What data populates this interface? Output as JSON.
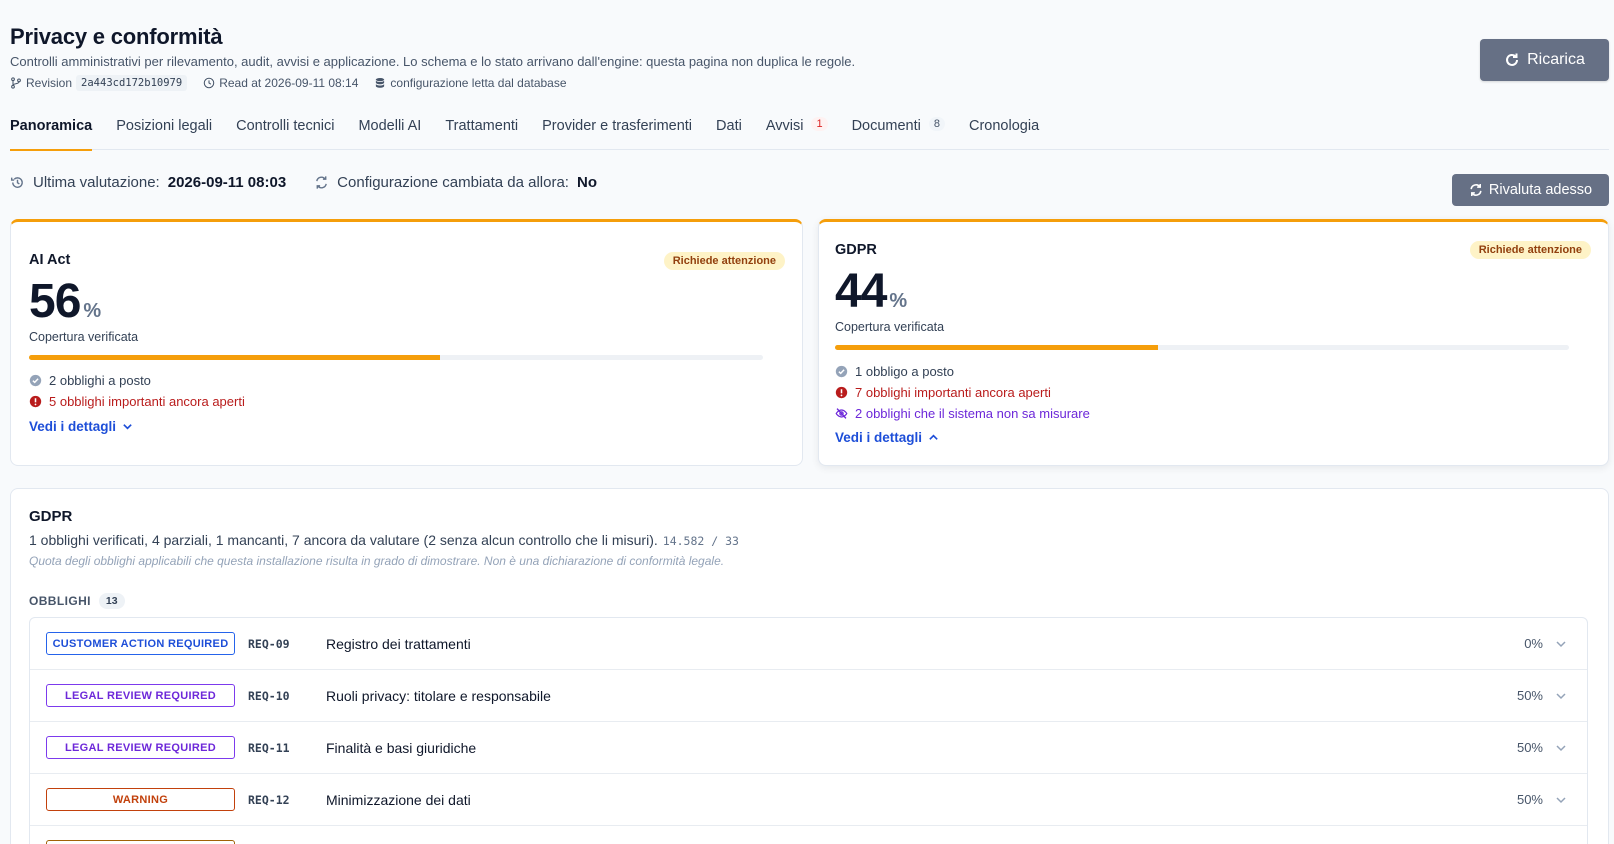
{
  "header": {
    "title": "Privacy e conformità",
    "subtitle": "Controlli amministrativi per rilevamento, audit, avvisi e applicazione. Lo schema e lo stato arrivano dall'engine: questa pagina non duplica le regole.",
    "revision_label": "Revision",
    "revision_code": "2a443cd172b10979",
    "read_at": "Read at 2026-09-11 08:14",
    "config_source": "configurazione letta dal database",
    "reload_label": "Ricarica"
  },
  "tabs": [
    {
      "label": "Panoramica",
      "active": true
    },
    {
      "label": "Posizioni legali"
    },
    {
      "label": "Controlli tecnici"
    },
    {
      "label": "Modelli AI"
    },
    {
      "label": "Trattamenti"
    },
    {
      "label": "Provider e trasferimenti"
    },
    {
      "label": "Dati"
    },
    {
      "label": "Avvisi",
      "badge": "1"
    },
    {
      "label": "Documenti",
      "badge": "8"
    },
    {
      "label": "Cronologia"
    }
  ],
  "evaluation": {
    "last_label": "Ultima valutazione:",
    "last_value": "2026-09-11 08:03",
    "changed_label": "Configurazione cambiata da allora:",
    "changed_value": "No",
    "reevaluate_label": "Rivaluta adesso"
  },
  "cards": {
    "ai_act": {
      "name": "AI Act",
      "status": "Richiede attenzione",
      "percent": "56",
      "percent_sign": "%",
      "coverage_label": "Copertura verificata",
      "coverage_fraction": 0.56,
      "ok": "2 obblighi a posto",
      "open": "5 obblighi importanti ancora aperti",
      "details": "Vedi i dettagli"
    },
    "gdpr": {
      "name": "GDPR",
      "status": "Richiede attenzione",
      "percent": "44",
      "percent_sign": "%",
      "coverage_label": "Copertura verificata",
      "coverage_fraction": 0.44,
      "ok": "1 obbligo a posto",
      "open": "7 obblighi importanti ancora aperti",
      "unmeasurable": "2 obblighi che il sistema non sa misurare",
      "details": "Vedi i dettagli"
    }
  },
  "gdpr_panel": {
    "title": "GDPR",
    "summary": "1 obblighi verificati, 4 parziali, 1 mancanti, 7 ancora da valutare (2 senza alcun controllo che li misuri).",
    "score": "14.582 / 33",
    "note": "Quota degli obblighi applicabili che questa installazione risulta in grado di dimostrare. Non è una dichiarazione di conformità legale.",
    "obligations_label": "OBBLIGHI",
    "obligations_count": "13",
    "rows": [
      {
        "tag": "CUSTOMER ACTION REQUIRED",
        "id": "REQ-09",
        "title": "Registro dei trattamenti",
        "pct": "0%"
      },
      {
        "tag": "LEGAL REVIEW REQUIRED",
        "id": "REQ-10",
        "title": "Ruoli privacy: titolare e responsabile",
        "pct": "50%"
      },
      {
        "tag": "LEGAL REVIEW REQUIRED",
        "id": "REQ-11",
        "title": "Finalità e basi giuridiche",
        "pct": "50%"
      },
      {
        "tag": "WARNING",
        "id": "REQ-12",
        "title": "Minimizzazione dei dati",
        "pct": "50%"
      }
    ]
  },
  "colors": {
    "accent": "#f59e0b",
    "button": "#667085",
    "link": "#1d4ed8",
    "danger": "#b91c1c",
    "unmeasurable": "#6d28d9"
  }
}
